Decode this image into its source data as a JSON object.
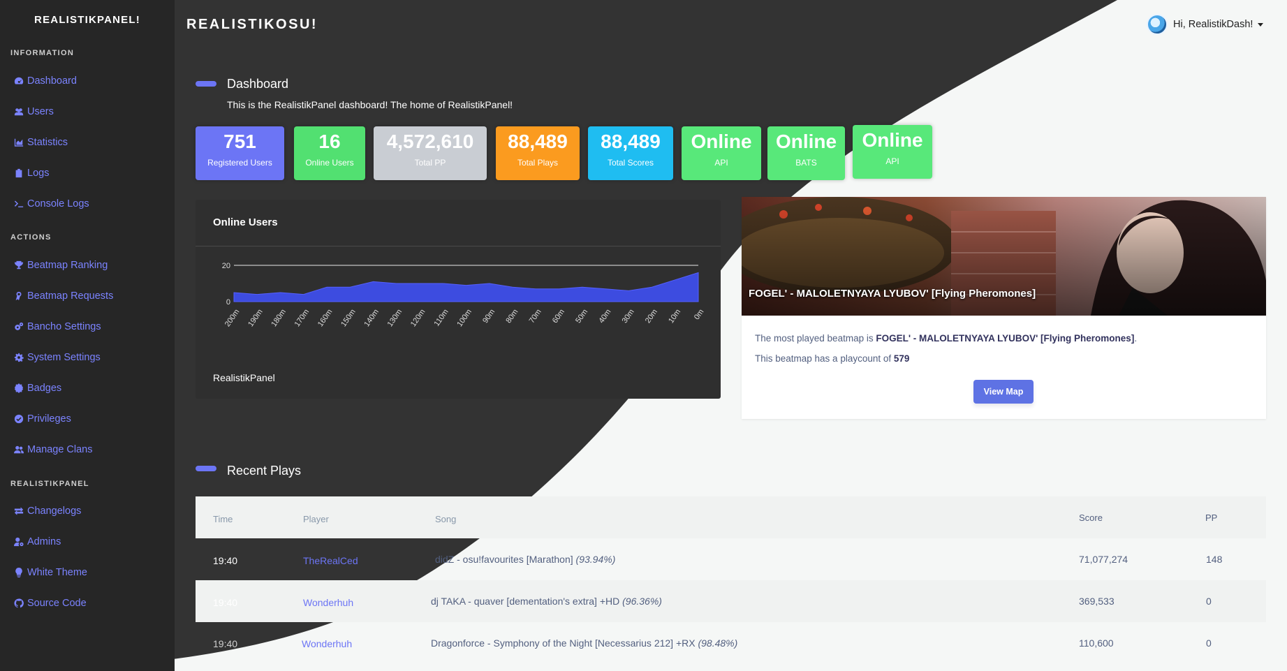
{
  "brand": "REALISTIKPANEL!",
  "header": {
    "title": "REALISTIKOSU!",
    "user_greeting": "Hi, RealistikDash!"
  },
  "sidebar": {
    "sections": [
      {
        "heading": "INFORMATION",
        "items": [
          {
            "label": "Dashboard",
            "icon": "dashboard-icon"
          },
          {
            "label": "Users",
            "icon": "users-icon"
          },
          {
            "label": "Statistics",
            "icon": "chart-icon"
          },
          {
            "label": "Logs",
            "icon": "clipboard-icon"
          },
          {
            "label": "Console Logs",
            "icon": "terminal-icon"
          }
        ]
      },
      {
        "heading": "ACTIONS",
        "items": [
          {
            "label": "Beatmap Ranking",
            "icon": "trophy-icon"
          },
          {
            "label": "Beatmap Requests",
            "icon": "ribbon-icon"
          },
          {
            "label": "Bancho Settings",
            "icon": "cogs-icon"
          },
          {
            "label": "System Settings",
            "icon": "cog-icon"
          },
          {
            "label": "Badges",
            "icon": "certificate-icon"
          },
          {
            "label": "Privileges",
            "icon": "check-circle-icon"
          },
          {
            "label": "Manage Clans",
            "icon": "user-friends-icon"
          }
        ]
      },
      {
        "heading": "REALISTIKPANEL",
        "items": [
          {
            "label": "Changelogs",
            "icon": "exchange-icon"
          },
          {
            "label": "Admins",
            "icon": "user-cog-icon"
          },
          {
            "label": "White Theme",
            "icon": "lightbulb-icon"
          },
          {
            "label": "Source Code",
            "icon": "github-icon"
          }
        ]
      }
    ]
  },
  "dashboard": {
    "title": "Dashboard",
    "subtitle": "This is the RealistikPanel dashboard! The home of RealistikPanel!"
  },
  "stats": [
    {
      "value": "751",
      "label": "Registered Users",
      "color": "#6c75f5"
    },
    {
      "value": "16",
      "label": "Online Users",
      "color": "#52e071"
    },
    {
      "value": "4,572,610",
      "label": "Total PP",
      "color": "#c9cdd3"
    },
    {
      "value": "88,489",
      "label": "Total Plays",
      "color": "#fb9b1f"
    },
    {
      "value": "88,489",
      "label": "Total Scores",
      "color": "#1fbdf1"
    },
    {
      "value": "Online",
      "label": "API",
      "color": "#58e87a"
    },
    {
      "value": "Online",
      "label": "BATS",
      "color": "#58e87a"
    },
    {
      "value": "Online",
      "label": "API",
      "color": "#58e87a"
    }
  ],
  "online_chart": {
    "title": "Online Users",
    "footer": "RealistikPanel",
    "chart_data": {
      "type": "area",
      "x": [
        "200m",
        "190m",
        "180m",
        "170m",
        "160m",
        "150m",
        "140m",
        "130m",
        "120m",
        "110m",
        "100m",
        "90m",
        "80m",
        "70m",
        "60m",
        "50m",
        "40m",
        "30m",
        "20m",
        "10m",
        "0m"
      ],
      "series": [
        {
          "values": [
            5,
            4,
            5,
            4,
            8,
            8,
            11,
            10,
            10,
            10,
            9,
            10,
            8,
            7,
            7,
            8,
            7,
            6,
            8,
            12,
            16
          ]
        }
      ],
      "ylim": [
        0,
        20
      ],
      "yticks": [
        "20",
        "0"
      ],
      "color": "#3d4ce0"
    }
  },
  "most_played": {
    "title": "FOGEL' - MALOLETNYAYA LYUBOV' [Flying Pheromones]",
    "line1_prefix": "The most played beatmap is ",
    "line1_map": "FOGEL' - MALOLETNYAYA LYUBOV' [Flying Pheromones]",
    "line1_suffix": ".",
    "line2_prefix": "This beatmap has a playcount of ",
    "playcount": "579",
    "button": "View Map"
  },
  "recent_plays": {
    "title": "Recent Plays",
    "columns": {
      "time": "Time",
      "player": "Player",
      "song": "Song",
      "score": "Score",
      "pp": "PP"
    },
    "rows": [
      {
        "time": "19:40",
        "player": "TheRealCed",
        "song": "didZ - osu!favourites [Marathon]",
        "acc": "(93.94%)",
        "score": "71,077,274",
        "pp": "148"
      },
      {
        "time": "19:40",
        "player": "Wonderhuh",
        "song": "dj TAKA - quaver [dementation's extra] +HD",
        "acc": "(96.36%)",
        "score": "369,533",
        "pp": "0"
      },
      {
        "time": "19:40",
        "player": "Wonderhuh",
        "song": "Dragonforce - Symphony of the Night [Necessarius 212] +RX",
        "acc": "(98.48%)",
        "score": "110,600",
        "pp": "0"
      }
    ]
  },
  "theme_colors": {
    "dark_bg": "#333333",
    "sidebar": "#262626",
    "light_bg": "#f5f7f6",
    "accent": "#6c75f5"
  }
}
